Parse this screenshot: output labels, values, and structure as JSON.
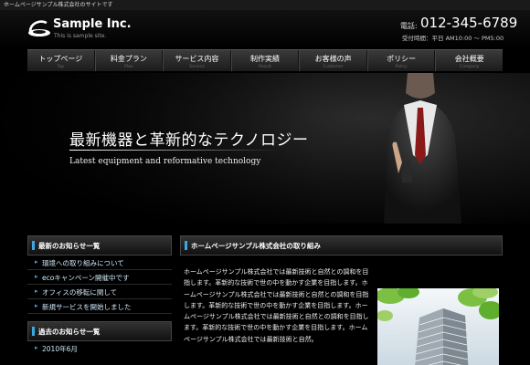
{
  "topbar": {
    "text": "ホームページサンプル株式会社のサイトです"
  },
  "header": {
    "company": "Sample Inc.",
    "tagline": "This is sample site.",
    "tel_label": "電話:",
    "tel_number": "012-345-6789",
    "hours": "受付時間：平日 AM10:00 ～ PM5:00"
  },
  "nav": {
    "items": [
      {
        "jp": "トップページ",
        "en": "Top"
      },
      {
        "jp": "料金プラン",
        "en": "Plan"
      },
      {
        "jp": "サービス内容",
        "en": "Service"
      },
      {
        "jp": "制作実績",
        "en": "Result"
      },
      {
        "jp": "お客様の声",
        "en": "Customer"
      },
      {
        "jp": "ポリシー",
        "en": "Policy"
      },
      {
        "jp": "会社概要",
        "en": "Company"
      }
    ]
  },
  "hero": {
    "title": "最新機器と革新的なテクノロジー",
    "subtitle": "Latest equipment and reformative technology"
  },
  "sidebar": {
    "news_title": "最新のお知らせ一覧",
    "news": [
      "環境への取り組みについて",
      "ecoキャンペーン開催中です",
      "オフィスの移転に関して",
      "新規サービスを開始しました"
    ],
    "past_title": "過去のお知らせ一覧",
    "past": [
      "2010年6月"
    ]
  },
  "main": {
    "title": "ホームページサンプル株式会社の取り組み",
    "body": "ホームページサンプル株式会社では最新技術と自然との調和を目指します。革新的な技術で世の中を動かす企業を目指します。ホームページサンプル株式会社では最新技術と自然との調和を目指します。革新的な技術で世の中を動かす企業を目指します。ホームページサンプル株式会社では最新技術と自然との調和を目指します。革新的な技術で世の中を動かす企業を目指します。ホームページサンプル株式会社では最新技術と自然。"
  },
  "colors": {
    "accent": "#3aa7e0",
    "link": "#cfe8f7",
    "background": "#000000"
  }
}
